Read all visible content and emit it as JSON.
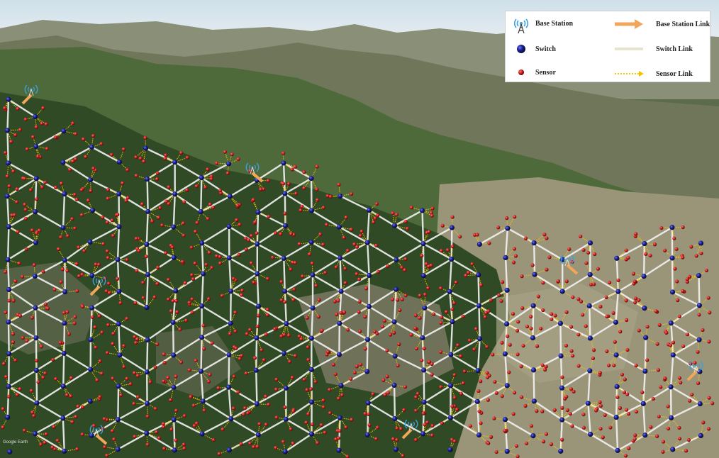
{
  "legend": {
    "base_station": "Base Station",
    "switch": "Switch",
    "sensor": "Sensor",
    "base_station_link": "Base Station Link",
    "switch_link": "Switch Link",
    "sensor_link": "Sensor Link"
  },
  "colors": {
    "switch": "#1a1f8c",
    "sensor": "#c81e1e",
    "switch_link": "#f2f2f2",
    "sensor_link": "#f5c400",
    "base_station_link": "#f2a65a",
    "base_station": "#3aa0e0"
  },
  "icons": {
    "base_station": "radio-tower-icon",
    "switch": "blue-sphere-icon",
    "sensor": "red-sphere-icon"
  },
  "watermark": "Google Earth"
}
